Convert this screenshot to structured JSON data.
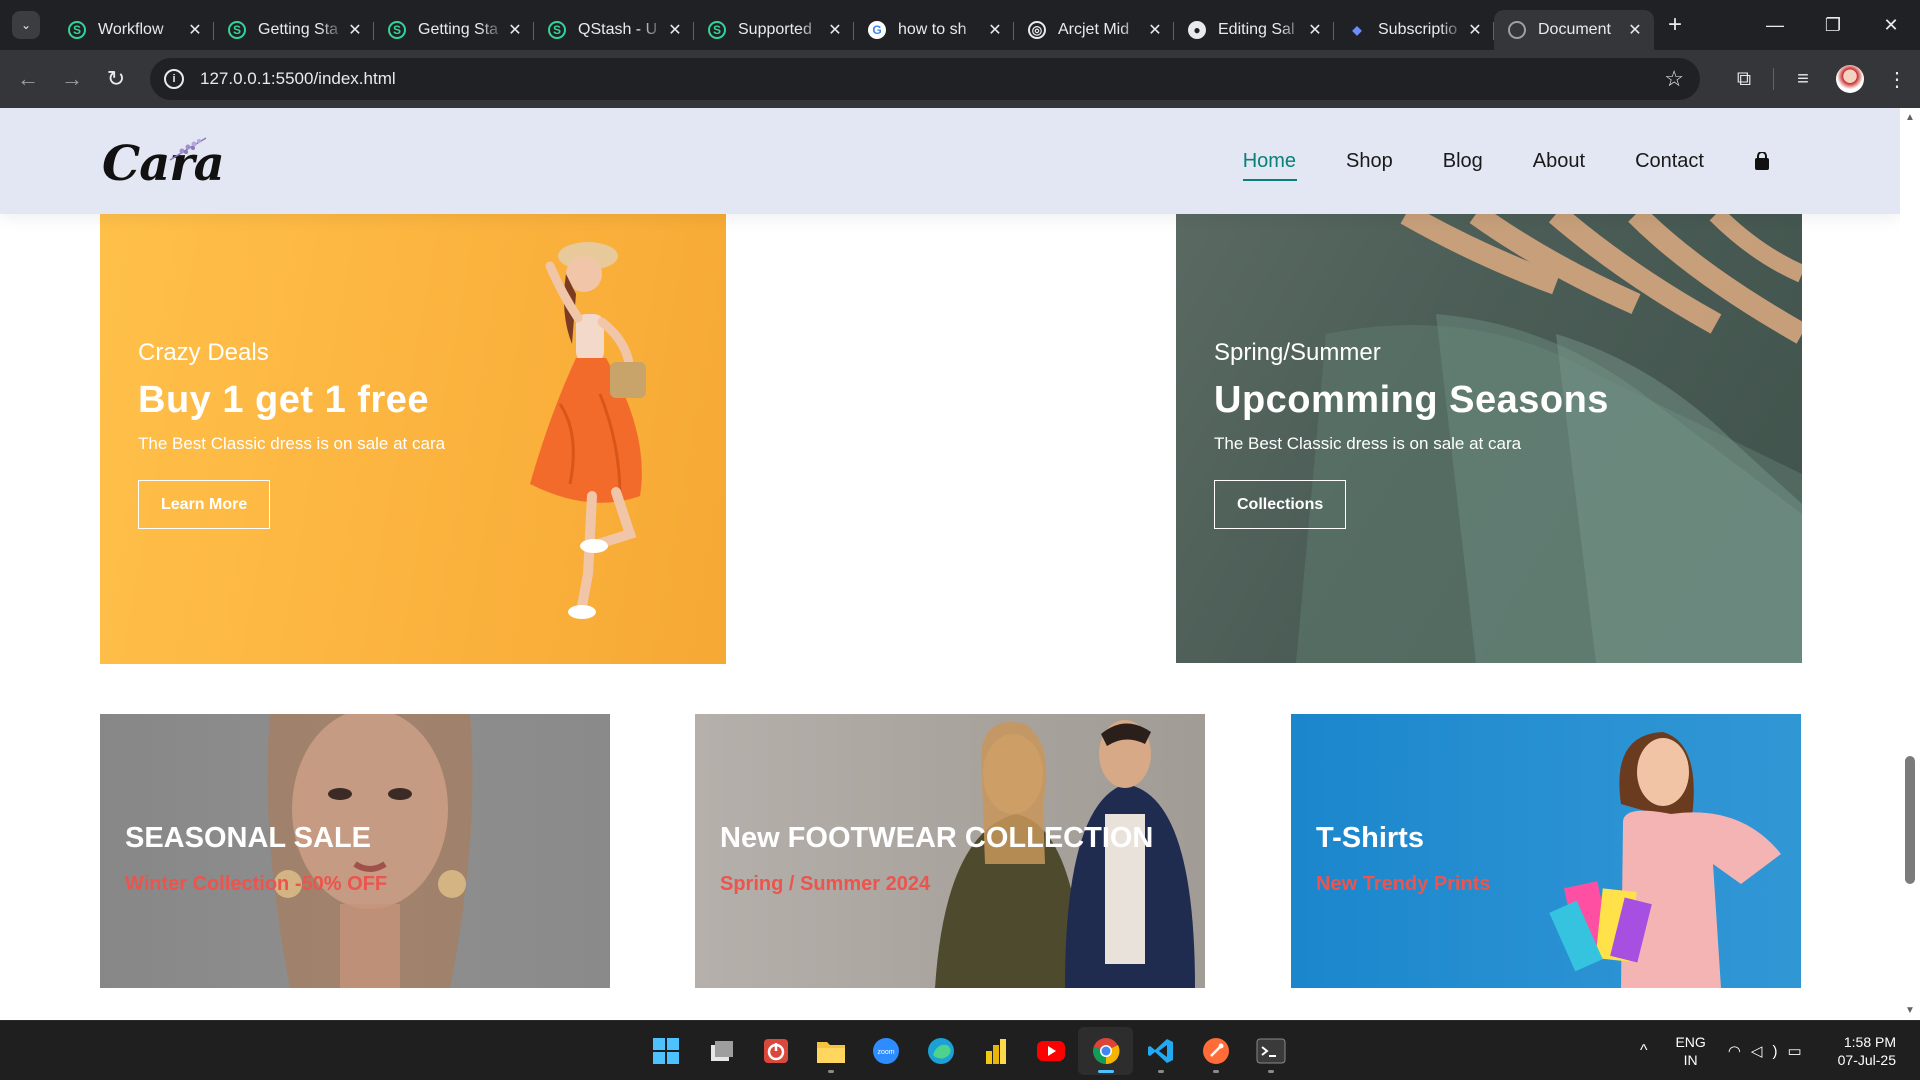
{
  "browser": {
    "tabs": [
      {
        "title": "Workflow",
        "icon": "qstash-icon",
        "active": false
      },
      {
        "title": "Getting Sta",
        "icon": "qstash-icon",
        "active": false
      },
      {
        "title": "Getting Sta",
        "icon": "qstash-icon",
        "active": false
      },
      {
        "title": "QStash - U",
        "icon": "qstash-icon",
        "active": false
      },
      {
        "title": "Supported",
        "icon": "qstash-icon",
        "active": false
      },
      {
        "title": "how to sh",
        "icon": "google-icon",
        "active": false
      },
      {
        "title": "Arcjet Mid",
        "icon": "arcjet-icon",
        "active": false
      },
      {
        "title": "Editing Sal",
        "icon": "github-icon",
        "active": false
      },
      {
        "title": "Subscriptio",
        "icon": "subscription-icon",
        "active": false
      },
      {
        "title": "Document",
        "icon": "globe-icon",
        "active": true
      }
    ],
    "url": "127.0.0.1:5500/index.html"
  },
  "site": {
    "logo": "Cara",
    "nav": [
      {
        "label": "Home",
        "active": true
      },
      {
        "label": "Shop",
        "active": false
      },
      {
        "label": "Blog",
        "active": false
      },
      {
        "label": "About",
        "active": false
      },
      {
        "label": "Contact",
        "active": false
      }
    ],
    "banner_left": {
      "kicker": "Crazy Deals",
      "title": "Buy 1 get 1 free",
      "subtitle": "The Best Classic dress is on sale at cara",
      "button": "Learn More"
    },
    "banner_right": {
      "kicker": "Spring/Summer",
      "title": "Upcomming Seasons",
      "subtitle": "The Best Classic dress is on sale at cara",
      "button": "Collections"
    },
    "small_banners": [
      {
        "title": "SEASONAL SALE",
        "subtitle": "Winter Collection -50% OFF"
      },
      {
        "title": "New FOOTWEAR COLLECTION",
        "subtitle": "Spring / Summer 2024"
      },
      {
        "title": "T-Shirts",
        "subtitle": "New Trendy Prints"
      }
    ],
    "colors": {
      "accent": "#088178",
      "header_bg": "#e3e6f3",
      "sale_red": "#ec544e"
    }
  },
  "taskbar": {
    "language": "ENG",
    "region": "IN",
    "time": "1:58 PM",
    "date": "07-Jul-25"
  }
}
